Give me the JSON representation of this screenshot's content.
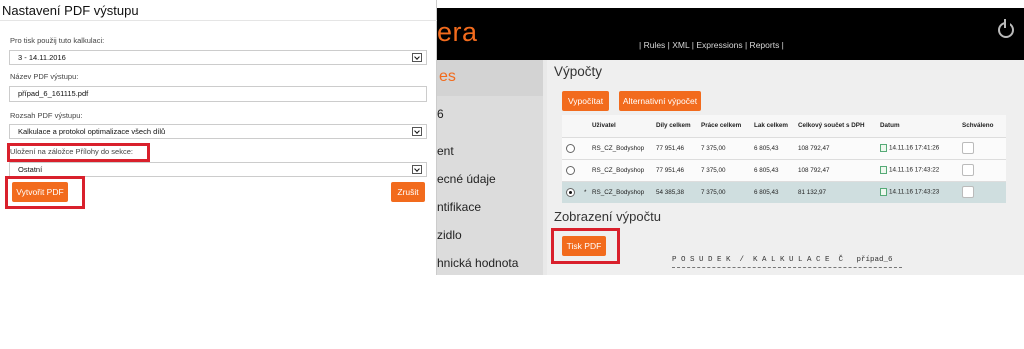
{
  "colors": {
    "accent": "#f26b1d",
    "highlight": "#d9202c",
    "selected_row": "#cfdedf"
  },
  "app": {
    "logo": "era",
    "topnav": "| Rules | XML | Expressions | Reports |",
    "power_icon": "power-icon",
    "leftnav": {
      "head": "es",
      "items": [
        "6",
        "ent",
        "ecné údaje",
        "ntifikace",
        "zidlo",
        "hnická hodnota"
      ]
    },
    "vypocty": {
      "title": "Výpočty",
      "btn_vypocitat": "Vypočítat",
      "btn_alternativni": "Alternativní výpočet",
      "columns": [
        "",
        "",
        "Uživatel",
        "Díly celkem",
        "Práce celkem",
        "Lak celkem",
        "Celkový součet s DPH",
        "Datum",
        "Schváleno"
      ],
      "rows": [
        {
          "marker": "",
          "user": "RS_CZ_Bodyshop",
          "dily": "77 951,46",
          "prace": "7 375,00",
          "lak": "6 805,43",
          "celkem": "108 792,47",
          "datum": "14.11.16 17:41:26"
        },
        {
          "marker": "",
          "user": "RS_CZ_Bodyshop",
          "dily": "77 951,46",
          "prace": "7 375,00",
          "lak": "6 805,43",
          "celkem": "108 792,47",
          "datum": "14.11.16 17:43:22"
        },
        {
          "marker": "*",
          "user": "RS_CZ_Bodyshop",
          "dily": "54 385,38",
          "prace": "7 375,00",
          "lak": "6 805,43",
          "celkem": "81 132,97",
          "datum": "14.11.16 17:43:23"
        }
      ],
      "selected_row": 3
    },
    "zobrazeni": {
      "title": "Zobrazení výpočtu",
      "btn_tisk": "Tisk PDF",
      "posudek": "P O S U D E K  /  K A L K U L A C E  Č   případ_6"
    }
  },
  "dialog": {
    "title": "Nastavení PDF výstupu",
    "label_kalkulace": "Pro tisk použij tuto kalkulaci:",
    "value_kalkulace": "3 - 14.11.2016",
    "label_nazev": "Název PDF výstupu:",
    "value_nazev": "případ_6_161115.pdf",
    "label_rozsah": "Rozsah PDF výstupu:",
    "value_rozsah": "Kalkulace a protokol optimalizace všech dílů",
    "label_ulozeni": "Uložení na záložce Přílohy do sekce:",
    "value_ulozeni": "Ostatní",
    "btn_vytvorit": "Vytvořit PDF",
    "btn_zrusit": "Zrušit"
  }
}
